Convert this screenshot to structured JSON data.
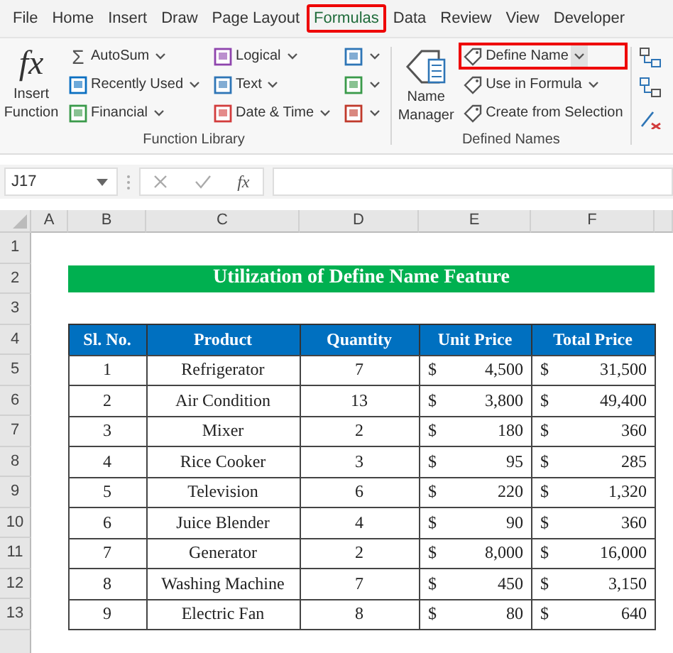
{
  "tabs": [
    {
      "label": "File",
      "selected": false,
      "highlighted": false
    },
    {
      "label": "Home",
      "selected": false,
      "highlighted": false
    },
    {
      "label": "Insert",
      "selected": false,
      "highlighted": false
    },
    {
      "label": "Draw",
      "selected": false,
      "highlighted": false
    },
    {
      "label": "Page Layout",
      "selected": false,
      "highlighted": false
    },
    {
      "label": "Formulas",
      "selected": true,
      "highlighted": true
    },
    {
      "label": "Data",
      "selected": false,
      "highlighted": false
    },
    {
      "label": "Review",
      "selected": false,
      "highlighted": false
    },
    {
      "label": "View",
      "selected": false,
      "highlighted": false
    },
    {
      "label": "Developer",
      "selected": false,
      "highlighted": false
    }
  ],
  "ribbon": {
    "groups": [
      {
        "label": "Function Library",
        "large_button": {
          "label": "Insert Function",
          "icon_text": "fx"
        },
        "columns": [
          [
            {
              "label": "AutoSum",
              "icon_text": "Σ",
              "dropdown": true,
              "highlighted": false
            },
            {
              "label": "Recently Used",
              "dropdown": true,
              "highlighted": false
            },
            {
              "label": "Financial",
              "dropdown": true,
              "highlighted": false
            }
          ],
          [
            {
              "label": "Logical",
              "dropdown": true,
              "highlighted": false
            },
            {
              "label": "Text",
              "dropdown": true,
              "highlighted": false
            },
            {
              "label": "Date & Time",
              "dropdown": true,
              "highlighted": false
            }
          ],
          [
            {
              "dropdown": true,
              "highlighted": false
            },
            {
              "dropdown": true,
              "highlighted": false
            },
            {
              "dropdown": true,
              "highlighted": false
            }
          ]
        ]
      },
      {
        "label": "Defined Names",
        "large_button": {
          "label": "Name Manager"
        },
        "columns": [
          [
            {
              "label": "Define Name",
              "dropdown": true,
              "highlighted": true
            },
            {
              "label": "Use in Formula",
              "dropdown": true,
              "highlighted": false
            },
            {
              "label": "Create from Selection",
              "dropdown": false,
              "highlighted": false
            }
          ]
        ]
      }
    ]
  },
  "formula_bar": {
    "name_box": "J17",
    "fx_label": "fx"
  },
  "sheet": {
    "column_headers": [
      "A",
      "B",
      "C",
      "D",
      "E",
      "F"
    ],
    "row_headers": [
      "1",
      "2",
      "3",
      "4",
      "5",
      "6",
      "7",
      "8",
      "9",
      "10",
      "11",
      "12",
      "13"
    ],
    "title": "Utilization of Define Name Feature",
    "table": {
      "columns": [
        "Sl. No.",
        "Product",
        "Quantity",
        "Unit Price",
        "Total Price"
      ],
      "rows": [
        {
          "sl": "1",
          "product": "Refrigerator",
          "quantity": "7",
          "unit_price": {
            "symbol": "$",
            "amount": "4,500"
          },
          "total_price": {
            "symbol": "$",
            "amount": "31,500"
          }
        },
        {
          "sl": "2",
          "product": "Air Condition",
          "quantity": "13",
          "unit_price": {
            "symbol": "$",
            "amount": "3,800"
          },
          "total_price": {
            "symbol": "$",
            "amount": "49,400"
          }
        },
        {
          "sl": "3",
          "product": "Mixer",
          "quantity": "2",
          "unit_price": {
            "symbol": "$",
            "amount": "180"
          },
          "total_price": {
            "symbol": "$",
            "amount": "360"
          }
        },
        {
          "sl": "4",
          "product": "Rice Cooker",
          "quantity": "3",
          "unit_price": {
            "symbol": "$",
            "amount": "95"
          },
          "total_price": {
            "symbol": "$",
            "amount": "285"
          }
        },
        {
          "sl": "5",
          "product": "Television",
          "quantity": "6",
          "unit_price": {
            "symbol": "$",
            "amount": "220"
          },
          "total_price": {
            "symbol": "$",
            "amount": "1,320"
          }
        },
        {
          "sl": "6",
          "product": "Juice Blender",
          "quantity": "4",
          "unit_price": {
            "symbol": "$",
            "amount": "90"
          },
          "total_price": {
            "symbol": "$",
            "amount": "360"
          }
        },
        {
          "sl": "7",
          "product": "Generator",
          "quantity": "2",
          "unit_price": {
            "symbol": "$",
            "amount": "8,000"
          },
          "total_price": {
            "symbol": "$",
            "amount": "16,000"
          }
        },
        {
          "sl": "8",
          "product": "Washing Machine",
          "quantity": "7",
          "unit_price": {
            "symbol": "$",
            "amount": "450"
          },
          "total_price": {
            "symbol": "$",
            "amount": "3,150"
          }
        },
        {
          "sl": "9",
          "product": "Electric Fan",
          "quantity": "8",
          "unit_price": {
            "symbol": "$",
            "amount": "80"
          },
          "total_price": {
            "symbol": "$",
            "amount": "640"
          }
        }
      ]
    }
  }
}
